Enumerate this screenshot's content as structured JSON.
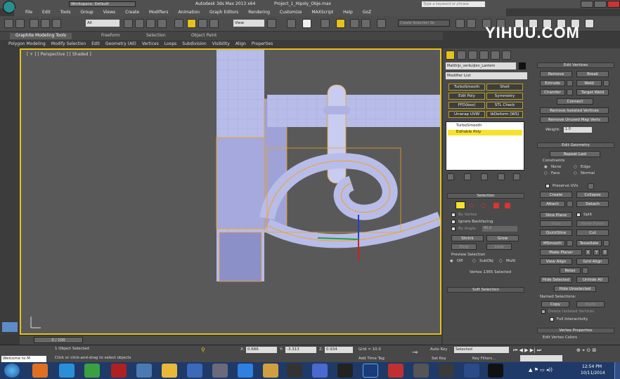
{
  "titlebar": {
    "workspace": "Workspace: Default",
    "app_title": "Autodesk 3ds Max 2013 x64",
    "file_title": "Project_1_Hipoly_Obje.max",
    "search_placeholder": "Type a keyword or phrase"
  },
  "menu": [
    "File",
    "Edit",
    "Tools",
    "Group",
    "Views",
    "Create",
    "Modifiers",
    "Animation",
    "Graph Editors",
    "Rendering",
    "Customize",
    "MAXScript",
    "Help",
    "GoZ"
  ],
  "toolbar": {
    "selection_filter": "All",
    "view": "View",
    "named_set": "Create Selection Se"
  },
  "ribbon": {
    "tabs": [
      "Graphite Modeling Tools",
      "Freeform",
      "Selection",
      "Object Paint"
    ],
    "subtabs": [
      "Polygon Modeling",
      "Modify Selection",
      "Edit",
      "Geometry (All)",
      "Vertices",
      "Loops",
      "Subdivision",
      "Visibility",
      "Align",
      "Properties"
    ]
  },
  "viewport": {
    "label": "[ + ] [ Perspective ] [ Shaded ]"
  },
  "watermark": {
    "text": "YIHUU.COM"
  },
  "command_panel": {
    "object_name": "Matthijs_verkuijlen_Lantern",
    "modifier_list": "Modifier List",
    "modifier_buttons": [
      "TurboSmooth",
      "Shell",
      "Edit Poly",
      "Symmetry",
      "FFD(box)",
      "STL Check",
      "Unwrap UVW",
      "tkDeform (WS)"
    ],
    "stack": [
      "TurboSmooth",
      "Editable Poly"
    ],
    "selection": {
      "title": "Selection",
      "by_vertex": "By Vertex",
      "ignore_backfacing": "Ignore Backfacing",
      "by_angle": "By Angle:",
      "angle": "45.0",
      "shrink": "Shrink",
      "grow": "Grow",
      "ring": "Ring",
      "loop": "Loop",
      "preview": "Preview Selection",
      "off": "Off",
      "subobj": "SubObj",
      "multi": "Multi",
      "status": "Vertex 1365 Selected"
    },
    "soft_selection": "Soft Selection"
  },
  "edit_vertices": {
    "title": "Edit Vertices",
    "remove": "Remove",
    "break": "Break",
    "extrude": "Extrude",
    "weld": "Weld",
    "chamfer": "Chamfer",
    "target_weld": "Target Weld",
    "connect": "Connect",
    "remove_isolated": "Remove Isolated Vertices",
    "remove_unused": "Remove Unused Map Verts",
    "weight_label": "Weight:",
    "weight": "1.0"
  },
  "edit_geometry": {
    "title": "Edit Geometry",
    "repeat_last": "Repeat Last",
    "constraints": "Constraints",
    "none": "None",
    "edge": "Edge",
    "face": "Face",
    "normal": "Normal",
    "preserve_uvs": "Preserve UVs",
    "create": "Create",
    "collapse": "Collapse",
    "attach": "Attach",
    "detach": "Detach",
    "slice_plane": "Slice Plane",
    "split": "Split",
    "slice": "Slice",
    "reset_plane": "Reset Plane",
    "quickslice": "QuickSlice",
    "cut": "Cut",
    "msmooth": "MSmooth",
    "tessellate": "Tessellate",
    "make_planar": "Make Planar",
    "x": "X",
    "y": "Y",
    "z": "Z",
    "view_align": "View Align",
    "grid_align": "Grid Align",
    "relax": "Relax",
    "hide_selected": "Hide Selected",
    "unhide_all": "Unhide All",
    "hide_unselected": "Hide Unselected",
    "named_selections": "Named Selections:",
    "copy": "Copy",
    "paste": "Paste",
    "delete_isolated": "Delete Isolated Vertices",
    "full_interactivity": "Full Interactivity"
  },
  "vertex_properties": {
    "title": "Vertex Properties",
    "edit_colors": "Edit Vertex Colors"
  },
  "timeline": {
    "frame": "0 / 100"
  },
  "status": {
    "selected": "1 Object Selected",
    "prompt": "Click or click-and-drag to select objects",
    "x_label": "X:",
    "x": "0.686",
    "y_label": "Y:",
    "y": "-3.313",
    "z_label": "Z:",
    "z": "0.934",
    "grid": "Grid = 10.0",
    "add_time_tag": "Add Time Tag",
    "auto_key": "Auto Key",
    "key_mode": "Selected",
    "set_key": "Set Key",
    "key_filters": "Key Filters...",
    "maxscript": "Welcome to M"
  },
  "taskbar": {
    "time": "12:54 PM",
    "date": "10/11/2014"
  },
  "colors": {
    "accent": "#e6c21a",
    "mesh": "#b8bce8",
    "selection": "#f3a21c",
    "taskbar": "#1f3a68"
  }
}
